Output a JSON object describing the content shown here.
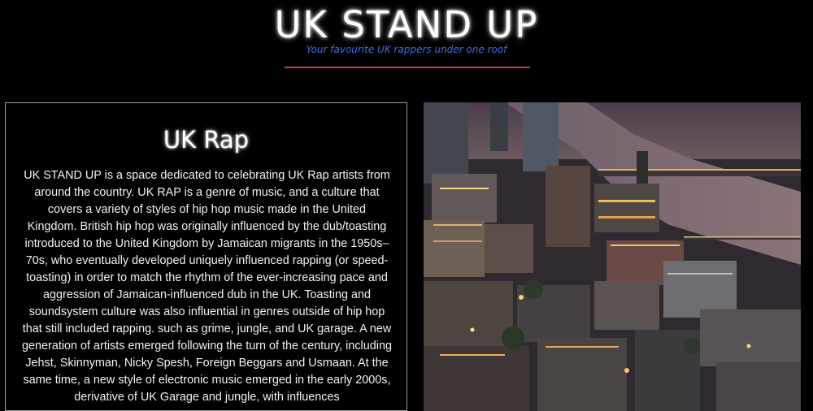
{
  "header": {
    "title": "UK STAND UP",
    "tagline": "Your favourite UK rappers under one roof"
  },
  "intro": {
    "heading": "UK Rap",
    "body": "UK STAND UP is a space dedicated to celebrating UK Rap artists from around the country. UK RAP is a genre of music, and a culture that covers a variety of styles of hip hop music made in the United Kingdom. British hip hop was originally influenced by the dub/toasting introduced to the United Kingdom by Jamaican migrants in the 1950s–70s, who eventually developed uniquely influenced rapping (or speed-toasting) in order to match the rhythm of the ever-increasing pace and aggression of Jamaican-influenced dub in the UK. Toasting and soundsystem culture was also influential in genres outside of hip hop that still included rapping. such as grime, jungle, and UK garage. A new generation of artists emerged following the turn of the century, including Jehst, Skinnyman, Nicky Spesh, Foreign Beggars and Usmaan. At the same time, a new style of electronic music emerged in the early 2000s, derivative of UK Garage and jungle, with influences"
  },
  "colors": {
    "background": "#000000",
    "tagline": "#3d6ee0",
    "divider": "#d9334f",
    "panel_border": "#9c9c9c"
  }
}
